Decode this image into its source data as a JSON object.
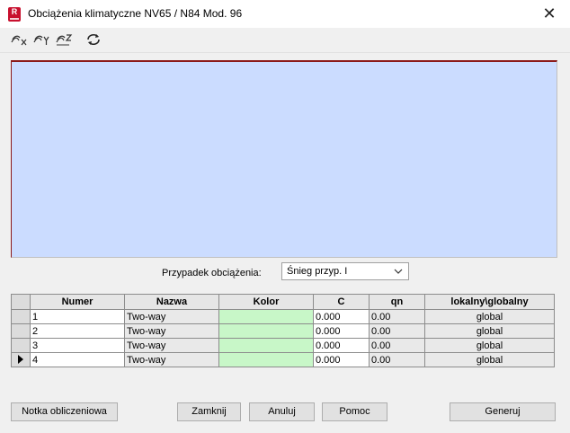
{
  "window": {
    "app_icon_letter": "R",
    "title": "Obciążenia klimatyczne  NV65 / N84 Mod. 96",
    "close_glyph": "✕"
  },
  "toolbar": {
    "buttons": [
      {
        "icon": "wind-x-icon"
      },
      {
        "icon": "wind-y-icon"
      },
      {
        "icon": "wind-z-icon"
      },
      {
        "icon": "refresh-icon"
      }
    ]
  },
  "colors": {
    "preview_bg": "#cbdcff",
    "color_cell": "#c8f7c8",
    "app_icon": "#c8102e"
  },
  "load_case": {
    "label": "Przypadek obciążenia:",
    "selected": "Śnieg przyp. I"
  },
  "table": {
    "headers": [
      "Numer",
      "Nazwa",
      "Kolor",
      "C",
      "qn",
      "lokalny\\globalny"
    ],
    "rows": [
      {
        "num": "1",
        "name": "Two-way",
        "c": "0.000",
        "qn": "0.00",
        "lg": "global",
        "current": false
      },
      {
        "num": "2",
        "name": "Two-way",
        "c": "0.000",
        "qn": "0.00",
        "lg": "global",
        "current": false
      },
      {
        "num": "3",
        "name": "Two-way",
        "c": "0.000",
        "qn": "0.00",
        "lg": "global",
        "current": false
      },
      {
        "num": "4",
        "name": "Two-way",
        "c": "0.000",
        "qn": "0.00",
        "lg": "global",
        "current": true
      }
    ]
  },
  "buttons": {
    "note": "Notka obliczeniowa",
    "close": "Zamknij",
    "cancel": "Anuluj",
    "help": "Pomoc",
    "generate": "Generuj"
  }
}
